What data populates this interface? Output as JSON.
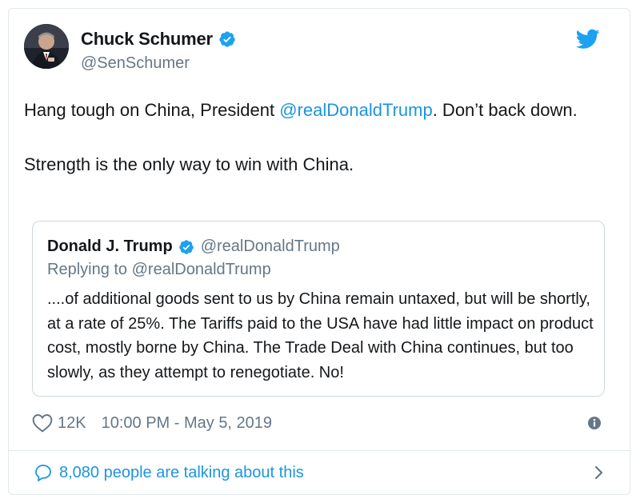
{
  "author": {
    "display_name": "Chuck Schumer",
    "handle": "@SenSchumer",
    "verified": true,
    "avatar_icon": "avatar-photo-icon"
  },
  "tweet": {
    "text_part1": "Hang tough on China, President ",
    "mention": "@realDonaldTrump",
    "text_part2": ". Don’t back down.",
    "paragraph2": "Strength is the only way to win with China."
  },
  "quoted_tweet": {
    "display_name": "Donald J. Trump",
    "handle": "@realDonaldTrump",
    "verified": true,
    "reply_context": "Replying to @realDonaldTrump",
    "text": "....of additional goods sent to us by China remain untaxed, but will be shortly, at a rate of 25%. The Tariffs paid to the USA have had little impact on product cost, mostly borne by China. The Trade Deal with China continues, but too slowly, as they attempt to renegotiate. No!"
  },
  "meta": {
    "likes": "12K",
    "timestamp": "10:00 PM - May 5, 2019"
  },
  "footer": {
    "talking_text": "8,080 people are talking about this"
  },
  "colors": {
    "accent": "#1b95e0",
    "twitter_blue": "#1da1f2",
    "text_primary": "#14171a",
    "text_secondary": "#657786",
    "border": "#e1e8ed"
  }
}
